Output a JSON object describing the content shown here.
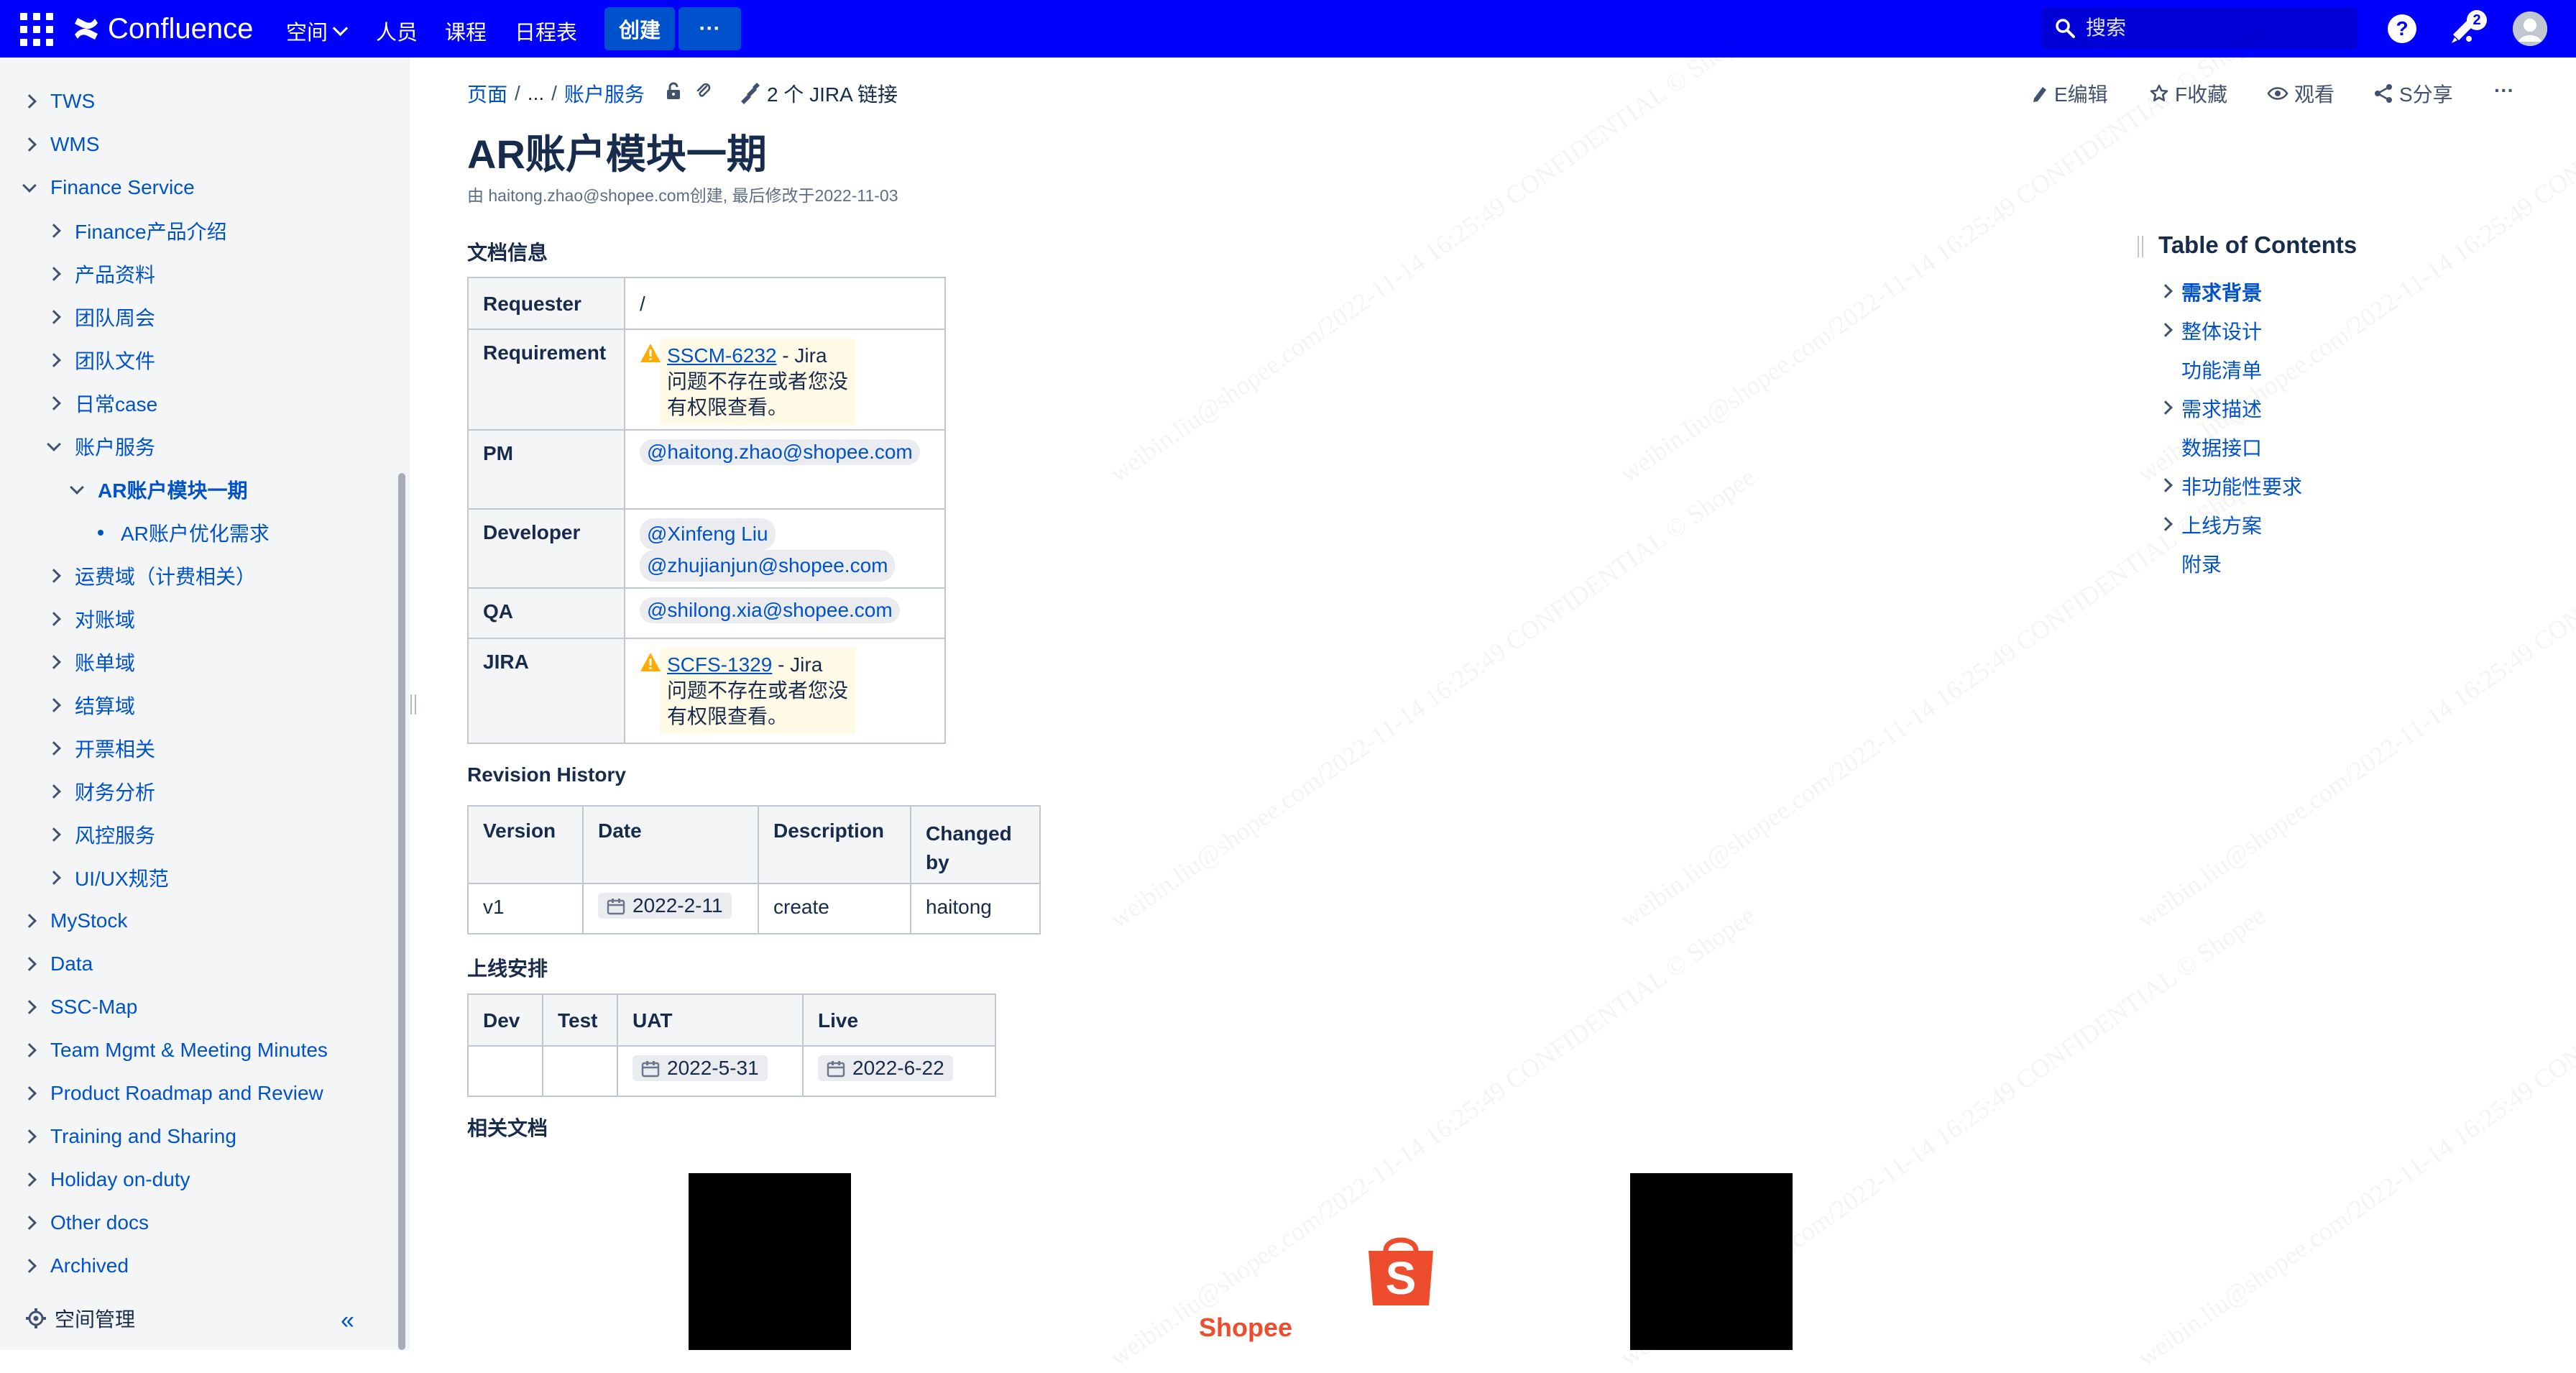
{
  "topbar": {
    "logo_text": "Confluence",
    "nav": [
      {
        "label": "空间",
        "dropdown": true
      },
      {
        "label": "人员"
      },
      {
        "label": "课程"
      },
      {
        "label": "日程表"
      }
    ],
    "create_label": "创建",
    "more_label": "···",
    "search_placeholder": "搜索",
    "notification_count": "2",
    "colors": {
      "bar": "#0000ff",
      "button": "#0052cc"
    }
  },
  "sidebar": {
    "items": [
      {
        "label": "TWS"
      },
      {
        "label": "WMS"
      },
      {
        "label": "Finance Service"
      },
      {
        "label": "Finance产品介绍"
      },
      {
        "label": "产品资料"
      },
      {
        "label": "团队周会"
      },
      {
        "label": "团队文件"
      },
      {
        "label": "日常case"
      },
      {
        "label": "账户服务"
      },
      {
        "label": "AR账户模块一期"
      },
      {
        "label": "AR账户优化需求"
      },
      {
        "label": "运费域（计费相关）"
      },
      {
        "label": "对账域"
      },
      {
        "label": "账单域"
      },
      {
        "label": "结算域"
      },
      {
        "label": "开票相关"
      },
      {
        "label": "财务分析"
      },
      {
        "label": "风控服务"
      },
      {
        "label": "UI/UX规范"
      },
      {
        "label": "MyStock"
      },
      {
        "label": "Data"
      },
      {
        "label": "SSC-Map"
      },
      {
        "label": "Team Mgmt & Meeting Minutes"
      },
      {
        "label": "Product Roadmap and Review"
      },
      {
        "label": "Training and Sharing"
      },
      {
        "label": "Holiday on-duty"
      },
      {
        "label": "Other docs"
      },
      {
        "label": "Archived"
      }
    ],
    "space_admin_label": "空间管理",
    "collapse_label": "«"
  },
  "breadcrumb": {
    "root": "页面",
    "ellipsis": "...",
    "parent": "账户服务",
    "jira_links": "2 个 JIRA 链接"
  },
  "actions": {
    "edit": "E编辑",
    "favorite": "F收藏",
    "watch": "观看",
    "share": "S分享",
    "more": "···"
  },
  "page": {
    "title": "AR账户模块一期",
    "byline": "由 haitong.zhao@shopee.com创建, 最后修改于2022-11-03"
  },
  "doc_info": {
    "heading": "文档信息",
    "requester_label": "Requester",
    "requester_value": "/",
    "requirement_label": "Requirement",
    "requirement_key": "SSCM-6232",
    "requirement_rest": " - Jira",
    "requirement_msg1": "问题不存在或者您没",
    "requirement_msg2": "有权限查看。",
    "pm_label": "PM",
    "pm_value": "@haitong.zhao@shopee.com",
    "dev_label": "Developer",
    "dev_value1": "@Xinfeng Liu",
    "dev_value2": "@zhujianjun@shopee.com",
    "qa_label": "QA",
    "qa_value": "@shilong.xia@shopee.com",
    "jira_label": "JIRA",
    "jira_key": "SCFS-1329",
    "jira_rest": " - Jira",
    "jira_msg1": "问题不存在或者您没",
    "jira_msg2": "有权限查看。"
  },
  "revision": {
    "heading": "Revision History",
    "headers": [
      "Version",
      "Date",
      "Description",
      "Changed by"
    ],
    "changed_by_l1": "Changed",
    "changed_by_l2": "by",
    "row": {
      "version": "v1",
      "date": "2022-2-11",
      "description": "create",
      "changed_by": "haitong"
    }
  },
  "launch": {
    "heading": "上线安排",
    "headers": [
      "Dev",
      "Test",
      "UAT",
      "Live"
    ],
    "uat": "2022-5-31",
    "live": "2022-6-22"
  },
  "related": {
    "heading": "相关文档"
  },
  "toc": {
    "title": "Table of Contents",
    "items": [
      "需求背景",
      "整体设计",
      "功能清单",
      "需求描述",
      "数据接口",
      "非功能性要求",
      "上线方案",
      "附录"
    ]
  },
  "video": {
    "brand_text": "Shopee",
    "brand_color": "#ee4d2d"
  },
  "watermark": "weibin.liu@shopee.com/2022-11-14 16:25:49 CONFIDENTIAL © Shopee"
}
